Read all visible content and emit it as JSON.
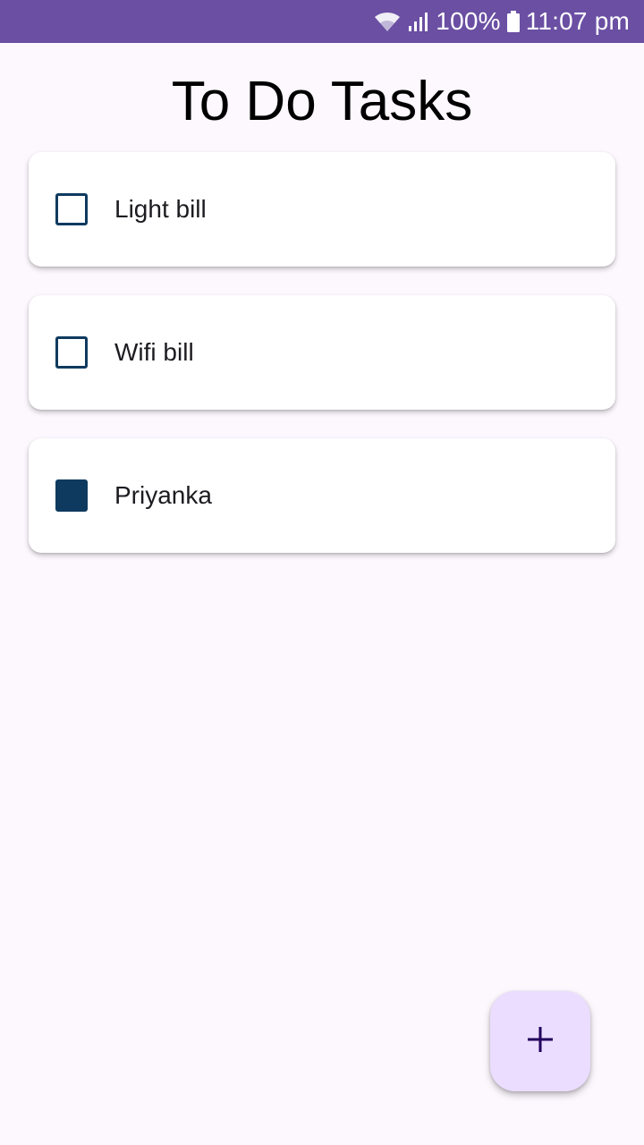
{
  "status_bar": {
    "battery": "100%",
    "time": "11:07 pm",
    "color": "#6a4fa3",
    "icons": [
      "wifi-icon",
      "signal-icon",
      "battery-icon"
    ]
  },
  "page": {
    "title": "To Do Tasks",
    "background": "#fdf7fe"
  },
  "tasks": [
    {
      "label": "Light bill",
      "checked": false
    },
    {
      "label": "Wifi bill",
      "checked": false
    },
    {
      "label": "Priyanka",
      "checked": true
    }
  ],
  "fab": {
    "icon": "plus-icon",
    "color": "#eaddff",
    "icon_color": "#21005d"
  },
  "accent": "#0f3a5f"
}
